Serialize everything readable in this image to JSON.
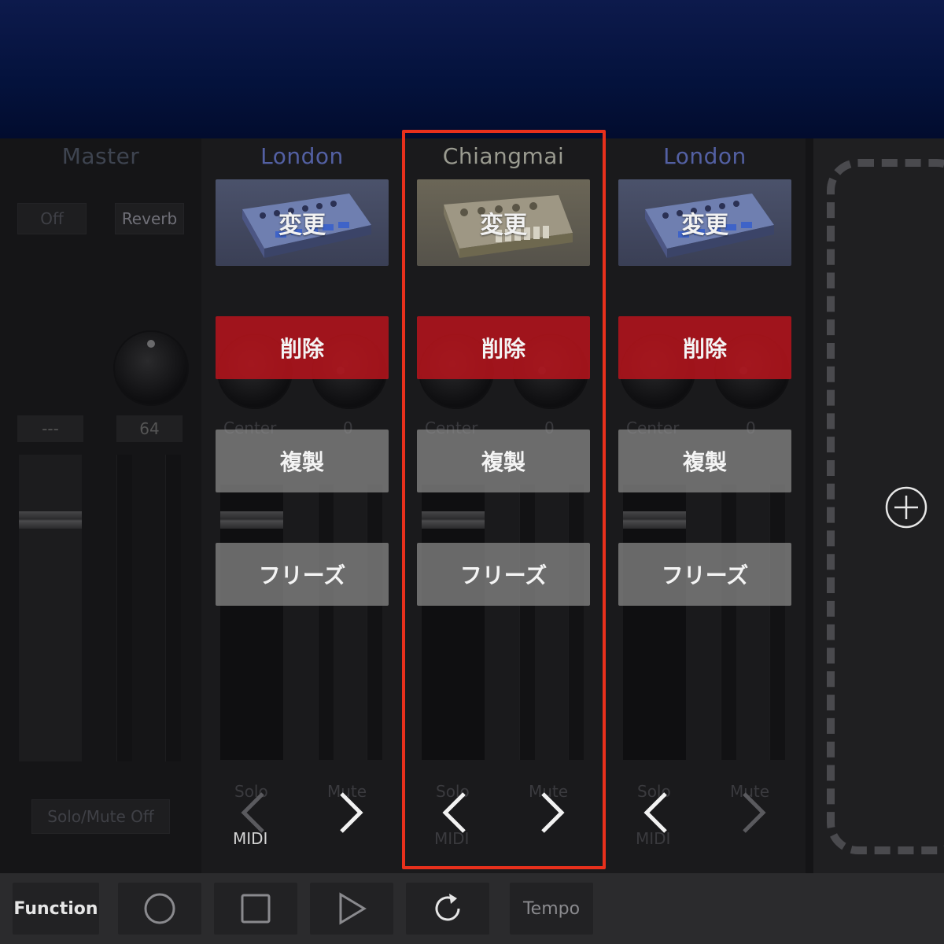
{
  "master": {
    "title": "Master",
    "off_label": "Off",
    "reverb_label": "Reverb",
    "left_value": "---",
    "right_value": "64",
    "solo_mute_off_label": "Solo/Mute Off"
  },
  "channels": [
    {
      "title": "London",
      "instrument_action": "変更",
      "delete_label": "削除",
      "duplicate_label": "複製",
      "freeze_label": "フリーズ",
      "pan_label": "Center",
      "value_label": "0",
      "solo_label": "Solo",
      "mute_label": "Mute",
      "midi_label": "MIDI",
      "instrument_icon": "synth-blue",
      "title_color": "#5360a3"
    },
    {
      "title": "Chiangmai",
      "instrument_action": "変更",
      "delete_label": "削除",
      "duplicate_label": "複製",
      "freeze_label": "フリーズ",
      "pan_label": "Center",
      "value_label": "0",
      "solo_label": "Solo",
      "mute_label": "Mute",
      "midi_label": "MIDI",
      "instrument_icon": "synth-tan",
      "title_color": "#9a9b90"
    },
    {
      "title": "London",
      "instrument_action": "変更",
      "delete_label": "削除",
      "duplicate_label": "複製",
      "freeze_label": "フリーズ",
      "pan_label": "Center",
      "value_label": "0",
      "solo_label": "Solo",
      "mute_label": "Mute",
      "midi_label": "MIDI",
      "instrument_icon": "synth-blue",
      "title_color": "#5360a3"
    }
  ],
  "toolbar": {
    "function_label": "Function",
    "tempo_label": "Tempo",
    "icons": [
      "record-icon",
      "stop-icon",
      "play-icon",
      "loop-icon"
    ]
  },
  "colors": {
    "highlight": "#e8301c",
    "delete": "#b9141c",
    "topbar": "#04123c"
  }
}
